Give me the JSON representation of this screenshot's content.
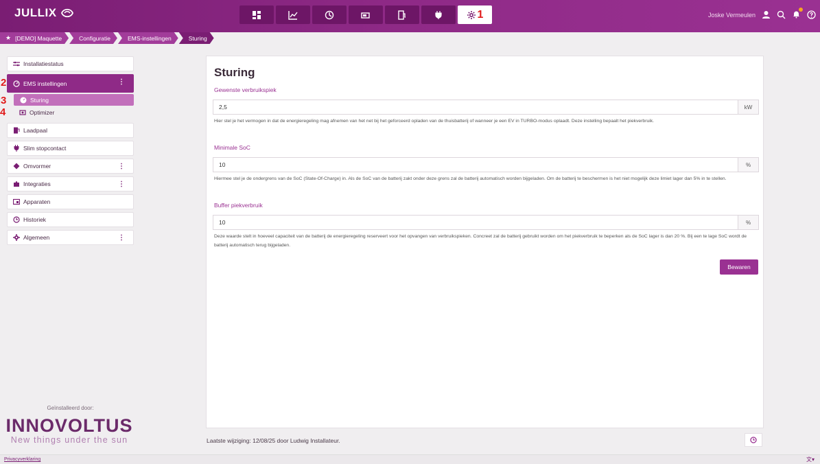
{
  "header": {
    "logo_text": "JULLIX",
    "nav_icons": [
      "dashboard-icon",
      "chart-icon",
      "energy-icon",
      "battery-icon",
      "charger-icon",
      "plug-icon",
      "settings-icon"
    ],
    "active_nav_annotation": "1",
    "user_name": "Joske Vermeulen"
  },
  "breadcrumb": {
    "items": [
      "[DEMO] Maquette",
      "Configuratie",
      "EMS-instellingen",
      "Sturing"
    ]
  },
  "sidebar": {
    "items": [
      {
        "label": "Installatiestatus"
      },
      {
        "label": "EMS instellingen",
        "annotation": "2"
      },
      {
        "label": "Sturing",
        "annotation": "3"
      },
      {
        "label": "Optimizer",
        "annotation": "4"
      },
      {
        "label": "Laadpaal"
      },
      {
        "label": "Slim stopcontact"
      },
      {
        "label": "Omvormer"
      },
      {
        "label": "Integraties"
      },
      {
        "label": "Apparaten"
      },
      {
        "label": "Historiek"
      },
      {
        "label": "Algemeen"
      }
    ],
    "installed_by": "Geïnstalleerd door:",
    "brand_name": "INNOVOLTUS",
    "brand_tagline": "New things under the sun"
  },
  "main": {
    "title": "Sturing",
    "fields": [
      {
        "label": "Gewenste verbruikspiek",
        "value": "2,5",
        "unit": "kW",
        "help": "Hier stel je het vermogen in dat de energieregeling mag afnemen van het net bij het geforceerd opladen van de thuisbatterij of wanneer je een EV in TURBO-modus oplaadt. Deze instelling bepaalt het piekverbruik."
      },
      {
        "label": "Minimale SoC",
        "value": "10",
        "unit": "%",
        "help": "Hiermee stel je de ondergrens van de SoC (State-Of-Charge) in. Als de SoC van de batterij zakt onder deze grens zal de batterij automatisch worden bijgeladen. Om de batterij te beschermen is het niet mogelijk deze limiet lager dan 5% in te stellen."
      },
      {
        "label": "Buffer piekverbruik",
        "value": "10",
        "unit": "%",
        "help": "Deze waarde stelt in hoeveel capaciteit van de batterij de energieregeling reserveert voor het opvangen van verbruikspieken. Concreet zal de batterij gebruikt worden om het piekverbruik te beperken als de SoC lager is dan 20 %. Bij een te lage SoC wordt de batterij automatisch terug bijgeladen."
      }
    ],
    "save_label": "Bewaren",
    "last_change": "Laatste wijziging: 12/08/25 door Ludwig Installateur."
  },
  "footer": {
    "privacy_label": "Privacyverklaring",
    "language_icon": "translate-icon"
  },
  "colors": {
    "brand": "#8f2a87",
    "brand_dark": "#7a1d73",
    "annotation": "#e01b1b"
  }
}
